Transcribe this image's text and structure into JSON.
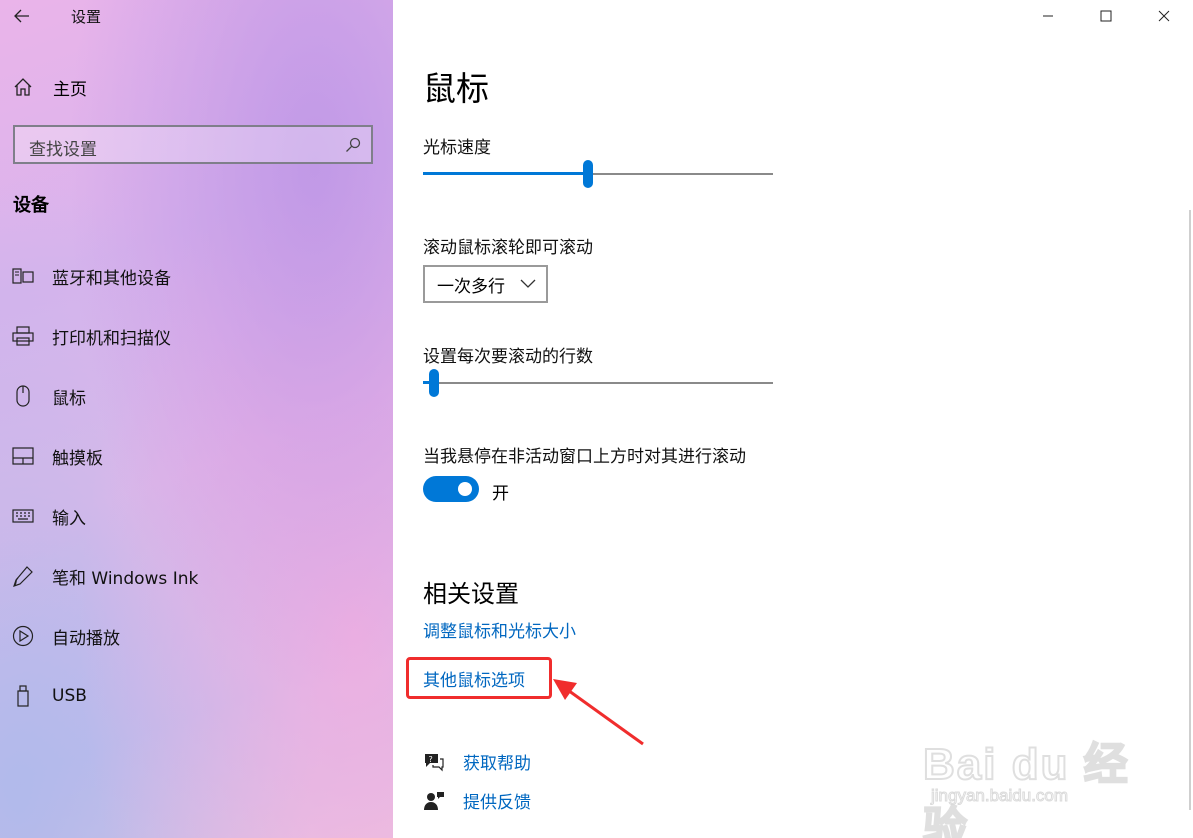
{
  "app": {
    "title": "设置"
  },
  "sidebar": {
    "home_label": "主页",
    "search_placeholder": "查找设置",
    "section_title": "设备",
    "items": [
      {
        "label": "蓝牙和其他设备",
        "icon": "bluetooth-devices-icon"
      },
      {
        "label": "打印机和扫描仪",
        "icon": "printer-icon"
      },
      {
        "label": "鼠标",
        "icon": "mouse-icon"
      },
      {
        "label": "触摸板",
        "icon": "touchpad-icon"
      },
      {
        "label": "输入",
        "icon": "keyboard-icon"
      },
      {
        "label": "笔和 Windows Ink",
        "icon": "pen-icon"
      },
      {
        "label": "自动播放",
        "icon": "autoplay-icon"
      },
      {
        "label": "USB",
        "icon": "usb-icon"
      }
    ]
  },
  "main": {
    "title": "鼠标",
    "cursor_speed": {
      "label": "光标速度",
      "value_fraction": 0.47
    },
    "scroll": {
      "label": "滚动鼠标滚轮即可滚动",
      "selected": "一次多行"
    },
    "lines_per_scroll": {
      "label": "设置每次要滚动的行数",
      "value_fraction": 0.03
    },
    "inactive_scroll": {
      "label": "当我悬停在非活动窗口上方时对其进行滚动",
      "state": "开",
      "on": true
    },
    "related": {
      "title": "相关设置",
      "links": [
        "调整鼠标和光标大小",
        "其他鼠标选项"
      ]
    },
    "help": {
      "get_help": "获取帮助",
      "feedback": "提供反馈"
    }
  },
  "colors": {
    "accent": "#0078d7",
    "link": "#0067c0",
    "annotation": "#f02d2d"
  },
  "watermark": {
    "brand": "Bai du 经验",
    "url": "jingyan.baidu.com"
  }
}
